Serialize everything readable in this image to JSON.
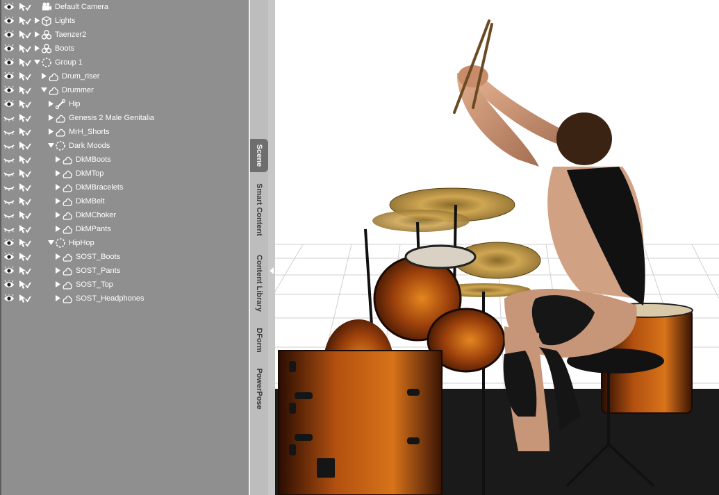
{
  "scene_tree": {
    "rows": [
      {
        "label": "Default Camera",
        "icon": "camera-icon",
        "expander": "none",
        "level": 0
      },
      {
        "label": "Lights",
        "icon": "light-cube-icon",
        "expander": "collapsed",
        "level": 0
      },
      {
        "label": "Taenzer2",
        "icon": "figure-icon",
        "expander": "collapsed",
        "level": 0
      },
      {
        "label": "Boots",
        "icon": "figure-icon",
        "expander": "collapsed",
        "level": 0
      },
      {
        "label": "Group 1",
        "icon": "group-icon",
        "expander": "expanded",
        "level": 0
      },
      {
        "label": "Drum_riser",
        "icon": "prop-icon",
        "expander": "collapsed",
        "level": 1
      },
      {
        "label": "Drummer",
        "icon": "prop-icon",
        "expander": "expanded",
        "level": 1
      },
      {
        "label": "Hip",
        "icon": "bone-icon",
        "expander": "collapsed",
        "level": 2
      },
      {
        "label": "Genesis 2 Male Genitalia",
        "icon": "prop-icon",
        "expander": "collapsed",
        "level": 2
      },
      {
        "label": "MrH_Shorts",
        "icon": "prop-icon",
        "expander": "collapsed",
        "level": 2
      },
      {
        "label": "Dark Moods",
        "icon": "group-icon",
        "expander": "expanded",
        "level": 2
      },
      {
        "label": "DkMBoots",
        "icon": "prop-icon",
        "expander": "collapsed",
        "level": 3
      },
      {
        "label": "DkMTop",
        "icon": "prop-icon",
        "expander": "collapsed",
        "level": 3
      },
      {
        "label": "DkMBracelets",
        "icon": "prop-icon",
        "expander": "collapsed",
        "level": 3
      },
      {
        "label": "DkMBelt",
        "icon": "prop-icon",
        "expander": "collapsed",
        "level": 3
      },
      {
        "label": "DkMChoker",
        "icon": "prop-icon",
        "expander": "collapsed",
        "level": 3
      },
      {
        "label": "DkMPants",
        "icon": "prop-icon",
        "expander": "collapsed",
        "level": 3
      },
      {
        "label": "HipHop",
        "icon": "group-icon",
        "expander": "expanded",
        "level": 2
      },
      {
        "label": "SOST_Boots",
        "icon": "prop-icon",
        "expander": "collapsed",
        "level": 3
      },
      {
        "label": "SOST_Pants",
        "icon": "prop-icon",
        "expander": "collapsed",
        "level": 3
      },
      {
        "label": "SOST_Top",
        "icon": "prop-icon",
        "expander": "collapsed",
        "level": 3
      },
      {
        "label": "SOST_Headphones",
        "icon": "prop-icon",
        "expander": "collapsed",
        "level": 3
      }
    ],
    "visibility": [
      "visible",
      "visible",
      "visible",
      "visible",
      "visible",
      "visible",
      "visible",
      "visible",
      "hidden",
      "hidden",
      "hidden",
      "hidden",
      "hidden",
      "hidden",
      "hidden",
      "hidden",
      "hidden",
      "visible",
      "visible",
      "visible",
      "visible",
      "visible"
    ]
  },
  "side_tabs": [
    {
      "label": "Scene",
      "active": true
    },
    {
      "label": "Smart Content",
      "active": false
    },
    {
      "label": "Content Library",
      "active": false
    },
    {
      "label": "DForm",
      "active": false
    },
    {
      "label": "PowerPose",
      "active": false
    }
  ],
  "colors": {
    "panel_bg": "#8f8f8f",
    "tab_strip_bg": "#bdbdbd",
    "active_tab_bg": "#6e6e6e",
    "viewport_bg": "#ffffff",
    "drum_shell": "#8a3a0a",
    "drum_glow": "#e07a1a",
    "cymbal": "#c9a14a"
  },
  "viewport": {
    "content": "3d-drummer-render"
  }
}
